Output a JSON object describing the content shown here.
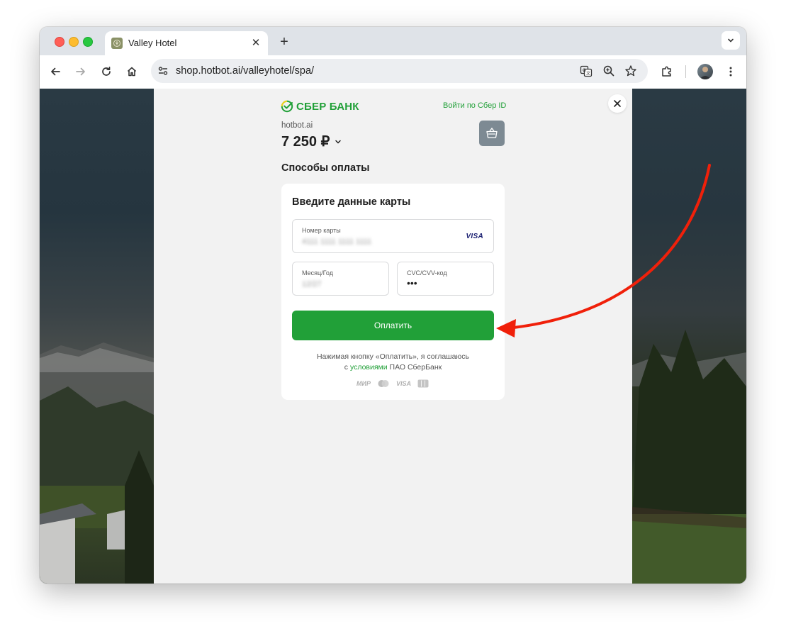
{
  "browser": {
    "tab_title": "Valley Hotel",
    "url": "shop.hotbot.ai/valleyhotel/spa/"
  },
  "payment": {
    "bank_name": "СБЕР БАНК",
    "sber_id_link": "Войти по Сбер ID",
    "merchant": "hotbot.ai",
    "amount": "7 250 ₽",
    "methods_title": "Способы оплаты",
    "card_title": "Введите данные карты",
    "card_number_label": "Номер карты",
    "card_number_value": "4111 1111 1111 1111",
    "card_brand": "VISA",
    "expiry_label": "Месяц/Год",
    "expiry_value": "12/27",
    "cvc_label": "CVC/CVV-код",
    "cvc_value": "•••",
    "pay_button": "Оплатить",
    "terms_line1": "Нажимая кнопку «Оплатить», я соглашаюсь",
    "terms_prefix": "с ",
    "terms_link": "условиями",
    "terms_suffix": " ПАО СберБанк",
    "payment_logos": [
      "МИР",
      "VISA"
    ]
  },
  "colors": {
    "sber_green": "#21a038",
    "annotation_arrow": "#f0200a"
  }
}
